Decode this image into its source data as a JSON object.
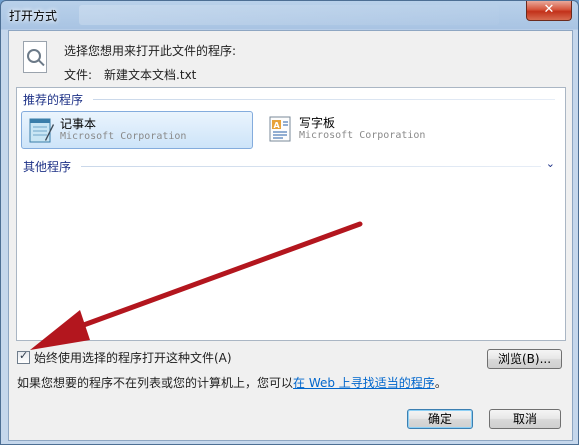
{
  "window": {
    "title": "打开方式",
    "close_glyph": "✕"
  },
  "header": {
    "prompt": "选择您想用来打开此文件的程序:",
    "file_label": "文件:",
    "file_name": "新建文本文档.txt"
  },
  "recommended": {
    "label": "推荐的程序",
    "apps": [
      {
        "name": "记事本",
        "vendor": "Microsoft Corporation",
        "selected": true
      },
      {
        "name": "写字板",
        "vendor": "Microsoft Corporation",
        "selected": false
      }
    ]
  },
  "other": {
    "label": "其他程序",
    "toggle_glyph": "⌄"
  },
  "always_use": {
    "label": "始终使用选择的程序打开这种文件(A)",
    "checked": true
  },
  "browse_label": "浏览(B)...",
  "hint": {
    "prefix": "如果您想要的程序不在列表或您的计算机上，您可以",
    "link": "在 Web 上寻找适当的程序",
    "suffix": "。"
  },
  "ok_label": "确定",
  "cancel_label": "取消",
  "annotation_color": "#b3161e"
}
